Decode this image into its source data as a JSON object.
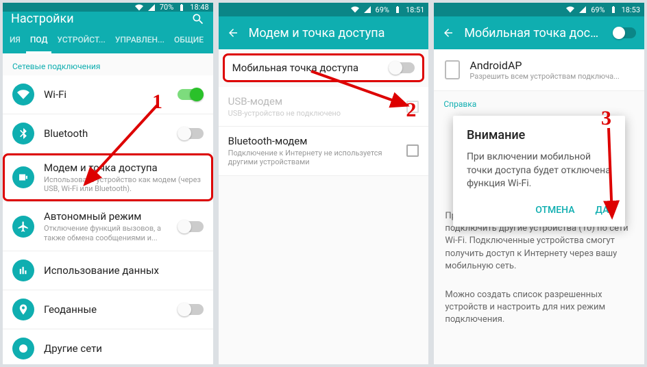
{
  "screen1": {
    "status": {
      "battery_pct": "70%",
      "time": "18:48"
    },
    "title": "Настройки",
    "tabs": [
      "ИЯ",
      "ПОД",
      "УСТРОЙСТ...",
      "УПРАВЛЕН...",
      "ОБЩИЕ"
    ],
    "section": "Сетевые подключения",
    "items": {
      "wifi": {
        "label": "Wi-Fi"
      },
      "bluetooth": {
        "label": "Bluetooth"
      },
      "tether": {
        "label": "Модем и точка доступа",
        "sub": "Использовать устройство как модем (через USB, Wi-Fi или Bluetooth)."
      },
      "airplane": {
        "label": "Автономный режим",
        "sub": "Отключение функций вызовов, а также обмена сообщениями и..."
      },
      "data": {
        "label": "Использование данных"
      },
      "geo": {
        "label": "Геоданные"
      },
      "other": {
        "label": "Другие сети"
      }
    },
    "marker": "1"
  },
  "screen2": {
    "status": {
      "battery_pct": "69%",
      "time": "18:51"
    },
    "title": "Модем и точка доступа",
    "items": {
      "hotspot": {
        "label": "Мобильная точка доступа"
      },
      "usb": {
        "label": "USB-модем",
        "sub": "USB-устройство не подключено"
      },
      "bt": {
        "label": "Bluetooth-модем",
        "sub": "Подключение к Интернету не используется другими устройствами"
      }
    },
    "marker": "2"
  },
  "screen3": {
    "status": {
      "battery_pct": "69%",
      "time": "18:53"
    },
    "title": "Мобильная точка дост...",
    "ap": {
      "name": "AndroidAP",
      "sub": "Разрешить всем устройствам подключа..."
    },
    "help_label": "Справка",
    "para1": "При этом к вашему устройству можно подключить другие устройства (10) по сети Wi-Fi. Подключенные устройства смогут получить доступ к Интернету через вашу мобильную сеть.",
    "para2": "Можно создать список разрешенных устройств и настроить для них режим подключения.",
    "dialog": {
      "title": "Внимание",
      "msg": "При включении мобильной точки доступа будет отключена функция Wi-Fi.",
      "cancel": "ОТМЕНА",
      "ok": "ДА"
    },
    "marker": "3"
  }
}
